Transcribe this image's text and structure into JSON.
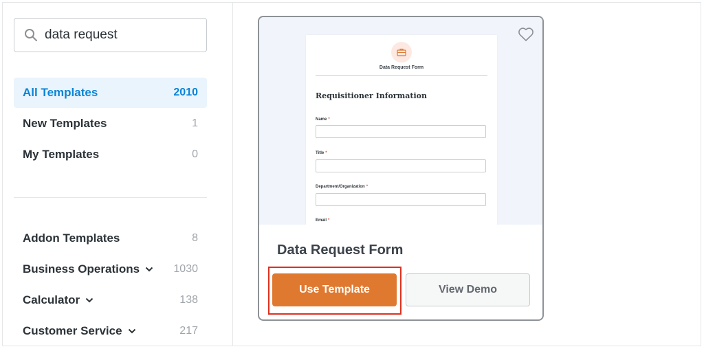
{
  "search": {
    "value": "data request",
    "icon": "search-icon"
  },
  "nav": {
    "primary": [
      {
        "label": "All Templates",
        "count": "2010",
        "active": true
      },
      {
        "label": "New Templates",
        "count": "1"
      },
      {
        "label": "My Templates",
        "count": "0"
      }
    ],
    "categories": [
      {
        "label": "Addon Templates",
        "count": "8"
      },
      {
        "label": "Business Operations",
        "count": "1030",
        "expandable": true
      },
      {
        "label": "Calculator",
        "count": "138",
        "expandable": true
      },
      {
        "label": "Customer Service",
        "count": "217",
        "expandable": true
      }
    ]
  },
  "card": {
    "title": "Data Request Form",
    "use_label": "Use Template",
    "demo_label": "View Demo",
    "favorite_icon": "heart-icon",
    "preview": {
      "icon": "briefcase-icon",
      "form_title": "Data Request Form",
      "section": "Requisitioner Information",
      "fields": [
        "Name",
        "Title",
        "Department/Organization",
        "Email"
      ],
      "required_mark": "*"
    }
  },
  "colors": {
    "accent": "#0a84d6",
    "primary_button": "#e07930",
    "highlight": "#e0301e"
  }
}
